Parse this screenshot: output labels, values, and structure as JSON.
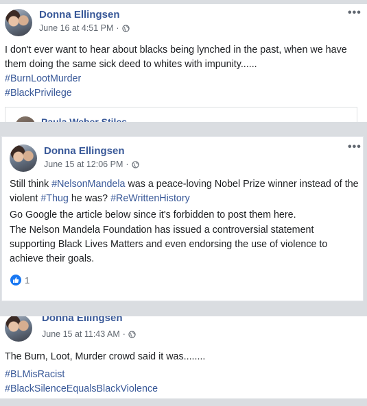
{
  "posts": [
    {
      "author": "Donna Ellingsen",
      "timestamp": "June 16 at 4:51 PM",
      "separator": "·",
      "privacy_icon": "globe-icon",
      "more_icon": "more-options-icon",
      "more_label": "•••",
      "body": "I don't ever want to hear about blacks being lynched in the past, when we have them doing the same sick deed to whites with impunity......",
      "hashtags": [
        "#BurnLootMurder",
        "#BlackPrivilege"
      ],
      "shared_author": "Paula Weber Stiles"
    },
    {
      "author": "Donna Ellingsen",
      "timestamp": "June 15 at 12:06 PM",
      "separator": "·",
      "privacy_icon": "globe-icon",
      "more_icon": "more-options-icon",
      "more_label": "•••",
      "para1": {
        "t1": "Still think ",
        "tag1": "#NelsonMandela",
        "t2": " was a peace-loving Nobel Prize winner instead of the violent ",
        "tag2": "#Thug",
        "t3": " he was? ",
        "tag3": "#ReWrittenHistory"
      },
      "para2": "Go Google the article below since it's forbidden to post them here.",
      "para3": "The Nelson Mandela Foundation has issued a controversial statement supporting Black Lives Matters and even endorsing the use of violence to achieve their goals.",
      "reaction_icon": "thumbs-up-icon",
      "reaction_count": "1"
    },
    {
      "author": "Donna Ellingsen",
      "timestamp": "June 15 at 11:43 AM",
      "separator": "·",
      "privacy_icon": "globe-icon",
      "body": "The Burn, Loot, Murder crowd said it was........",
      "hashtags": [
        "#BLMisRacist",
        "#BlackSilenceEqualsBlackViolence"
      ]
    }
  ],
  "colors": {
    "link": "#385898",
    "meta": "#606770",
    "like_blue": "#1877f2",
    "background": "#dadde1"
  }
}
